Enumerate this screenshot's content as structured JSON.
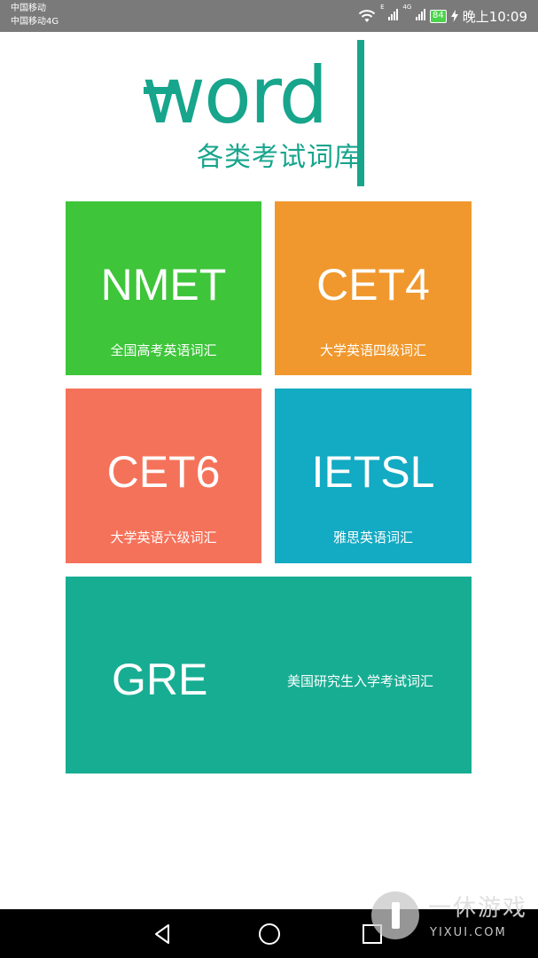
{
  "status_bar": {
    "carrier_1": "中国移动",
    "carrier_2": "中国移动4G",
    "net_tag_1": "E",
    "net_tag_2": "4G",
    "battery": "84",
    "time": "晚上10:09"
  },
  "logo": {
    "word": "word",
    "subtitle": "各类考试词库"
  },
  "tiles": [
    {
      "title": "NMET",
      "subtitle": "全国高考英语词汇",
      "color": "#3ec53a"
    },
    {
      "title": "CET4",
      "subtitle": "大学英语四级词汇",
      "color": "#f0982d"
    },
    {
      "title": "CET6",
      "subtitle": "大学英语六级词汇",
      "color": "#f5725a"
    },
    {
      "title": "IETSL",
      "subtitle": "雅思英语词汇",
      "color": "#13aac3"
    },
    {
      "title": "GRE",
      "subtitle": "美国研究生入学考试词汇",
      "color": "#17ad93"
    }
  ],
  "nav_bar": {
    "icons": [
      "back-triangle-icon",
      "home-circle-icon",
      "recent-square-icon"
    ]
  },
  "watermark": {
    "name": "一休游戏",
    "domain": "YIXUI.COM"
  }
}
